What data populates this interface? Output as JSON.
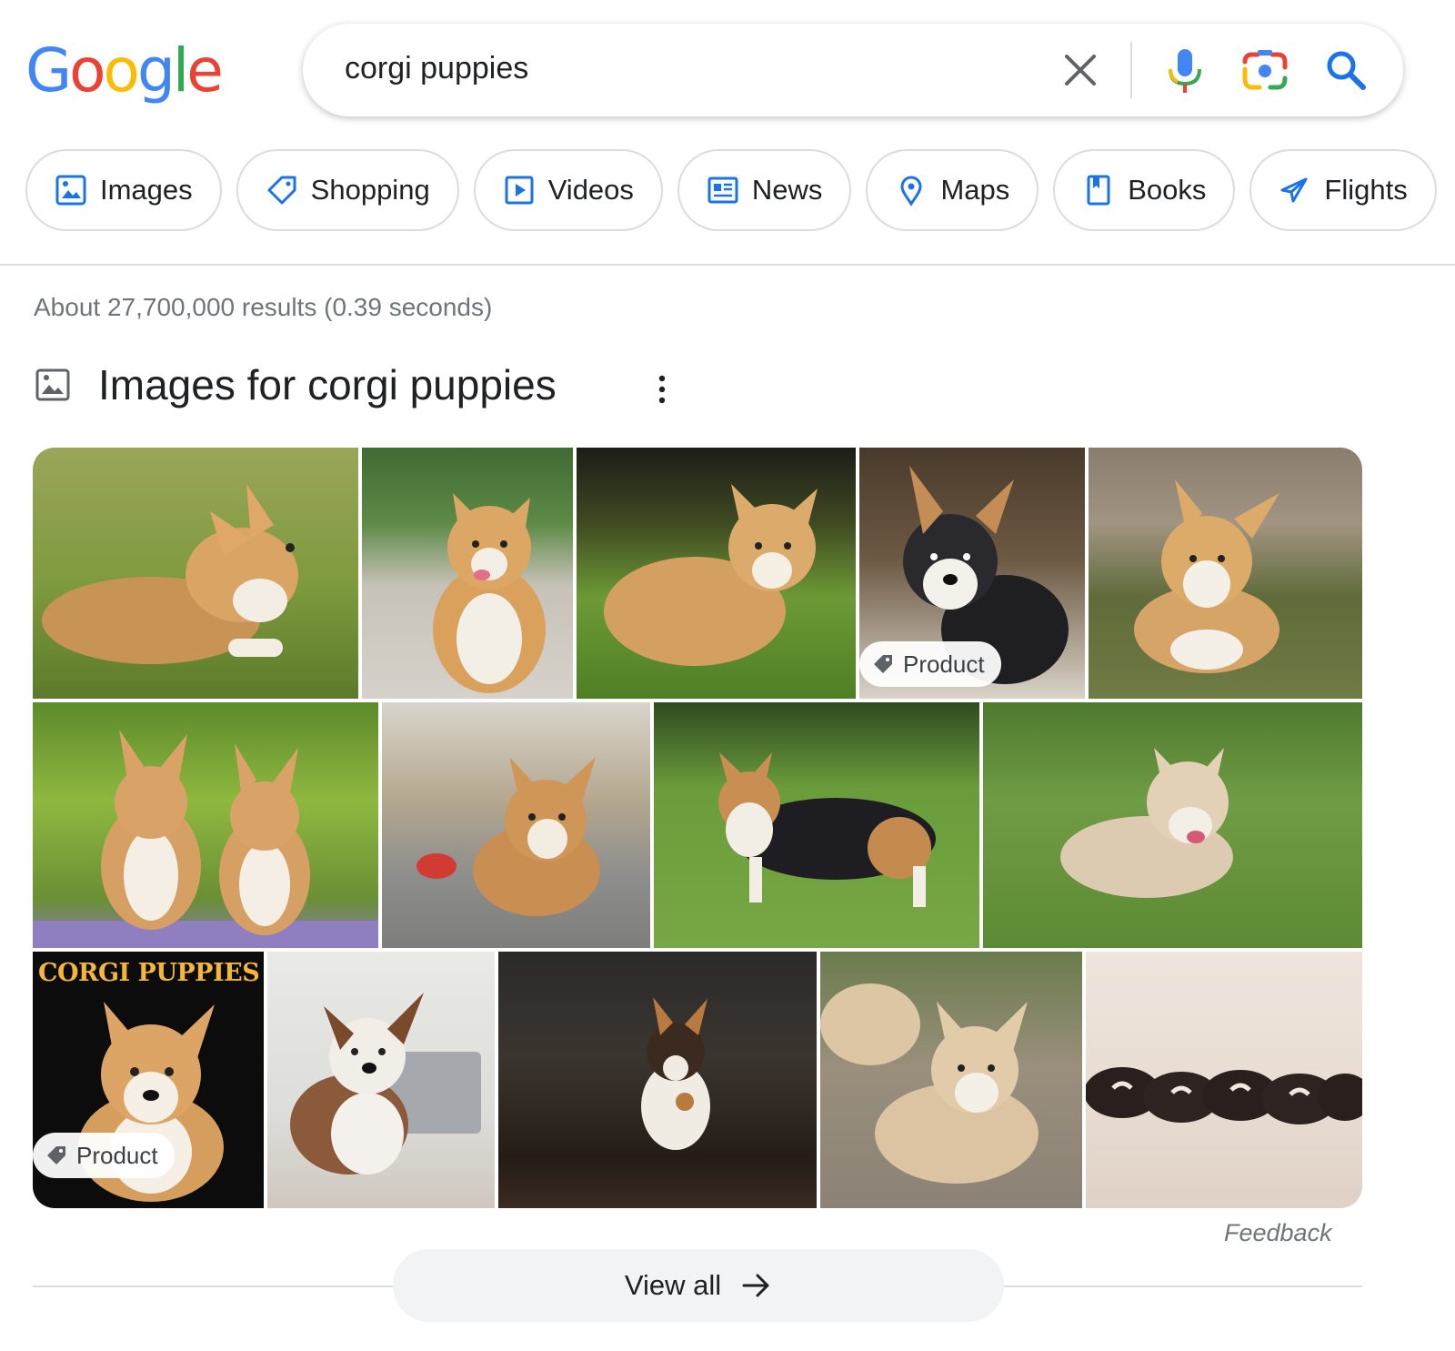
{
  "logo": {
    "letters": [
      "G",
      "o",
      "o",
      "g",
      "l",
      "e"
    ],
    "colors": [
      "#4285F4",
      "#EA4335",
      "#FBBC05",
      "#4285F4",
      "#34A853",
      "#EA4335"
    ]
  },
  "search": {
    "query": "corgi puppies",
    "icons": [
      "clear-icon",
      "microphone-icon",
      "camera-lens-icon",
      "search-icon"
    ]
  },
  "chips": [
    {
      "label": "Images",
      "icon": "image-icon"
    },
    {
      "label": "Shopping",
      "icon": "tag-icon"
    },
    {
      "label": "Videos",
      "icon": "play-icon"
    },
    {
      "label": "News",
      "icon": "news-icon"
    },
    {
      "label": "Maps",
      "icon": "map-pin-icon"
    },
    {
      "label": "Books",
      "icon": "bookmark-icon"
    },
    {
      "label": "Flights",
      "icon": "airplane-icon"
    }
  ],
  "result_stats": "About 27,700,000 results (0.39 seconds)",
  "images_section": {
    "title": "Images for corgi puppies",
    "badge_label": "Product",
    "cover_text": "CORGI PUPPIES",
    "feedback": "Feedback",
    "view_all": "View all"
  },
  "colors": {
    "accent": "#1a73e8",
    "muted": "#70757a",
    "border": "#dadce0",
    "chip_icon": "#1a73e8"
  }
}
